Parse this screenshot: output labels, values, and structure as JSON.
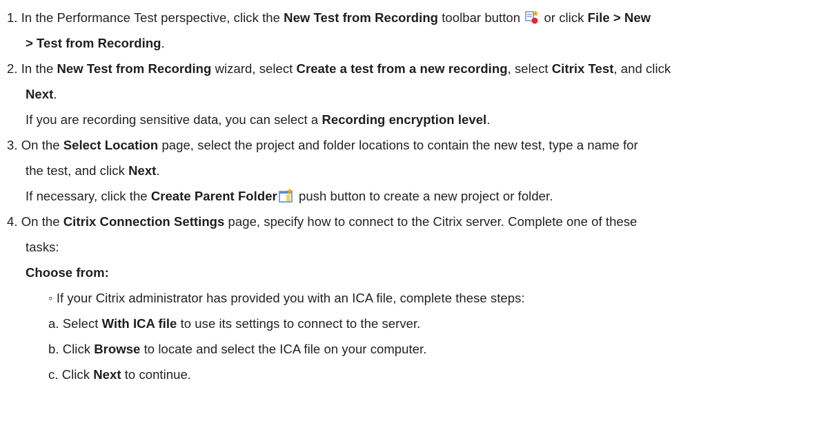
{
  "steps": [
    {
      "number": "1.",
      "intro": "In the Performance Test perspective, click the ",
      "button": "New Test from Recording",
      "after_button": " toolbar button ",
      "or_click": " or click ",
      "menu_a": "File > New",
      "menu_b": "> Test from Recording",
      "end": "."
    },
    {
      "number": "2.",
      "intro": "In the ",
      "wizard": "New Test from Recording",
      "mid1": " wizard, select ",
      "option": "Create a test from a new recording",
      "mid2": ", select ",
      "test_type": "Citrix Test",
      "mid3": ", and click",
      "next": "Next",
      "end": ".",
      "note_intro": "If you are recording sensitive data, you can select a ",
      "note_setting": "Recording encryption level",
      "note_end": "."
    },
    {
      "number": "3.",
      "intro": "On the ",
      "page": "Select Location",
      "mid1": " page, select the project and folder locations to contain the new test, type a name for",
      "cont": "the test, and click ",
      "next": "Next",
      "end": ".",
      "note_intro": "If necessary, click the ",
      "note_button": "Create Parent Folder",
      "note_end": " push button to create a new project or folder."
    },
    {
      "number": "4.",
      "intro": "On the ",
      "page": "Citrix Connection Settings",
      "mid1": " page, specify how to connect to the Citrix server. Complete one of these",
      "cont": "tasks:",
      "choose": "Choose from:",
      "bullet_mark": "◦",
      "bullet": "If your Citrix administrator has provided you with an ICA file, complete these steps:",
      "substeps": [
        {
          "letter": "a.",
          "pre": "Select ",
          "bold": "With ICA file",
          "post": " to use its settings to connect to the server."
        },
        {
          "letter": "b.",
          "pre": "Click ",
          "bold": "Browse",
          "post": " to locate and select the ICA file on your computer."
        },
        {
          "letter": "c.",
          "pre": "Click ",
          "bold": "Next",
          "post": " to continue."
        }
      ]
    }
  ],
  "icons": {
    "recording_icon": "new-test-from-recording-icon",
    "folder_icon": "create-parent-folder-icon",
    "record_color": "#e8262a",
    "page_color": "#5b8bd6",
    "star_color": "#f0a800",
    "folder_color": "#f5d36b"
  }
}
